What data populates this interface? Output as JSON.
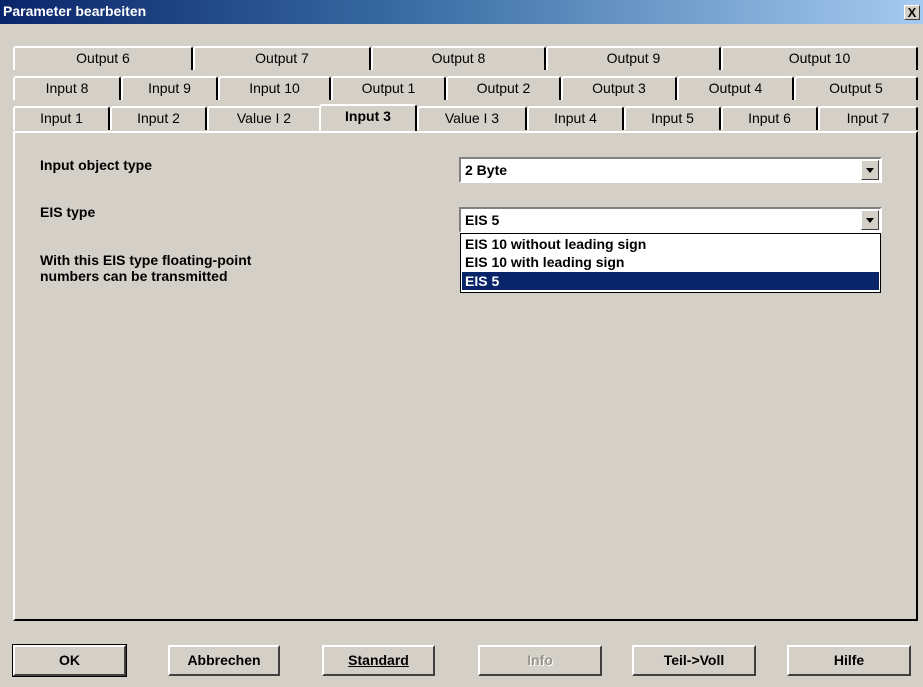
{
  "window": {
    "title": "Parameter bearbeiten",
    "close_label": "X"
  },
  "tabs": {
    "row1": [
      "Output 6",
      "Output 7",
      "Output 8",
      "Output 9",
      "Output 10"
    ],
    "row2": [
      "Input 8",
      "Input 9",
      "Input 10",
      "Output 1",
      "Output 2",
      "Output 3",
      "Output 4",
      "Output 5"
    ],
    "row3": [
      "Input 1",
      "Input 2",
      "Value I 2",
      "Input 3",
      "Value I 3",
      "Input 4",
      "Input 5",
      "Input 6",
      "Input 7"
    ],
    "active": "Input 3"
  },
  "form": {
    "input_object_type_label": "Input object type",
    "input_object_type_value": "2 Byte",
    "eis_type_label": "EIS type",
    "eis_type_value": "EIS 5",
    "description_line1": "With this EIS type floating-point",
    "description_line2": "numbers can be transmitted",
    "eis_options": [
      "EIS 10 without leading sign",
      "EIS 10 with leading sign",
      "EIS 5"
    ],
    "eis_selected_index": 2
  },
  "buttons": {
    "ok": "OK",
    "cancel": "Abbrechen",
    "standard": "Standard",
    "info": "Info",
    "teil_voll": "Teil->Voll",
    "hilfe": "Hilfe"
  },
  "colors": {
    "selection": "#0a246a",
    "face": "#d4d0c8",
    "titlebar": "#0a246a"
  }
}
